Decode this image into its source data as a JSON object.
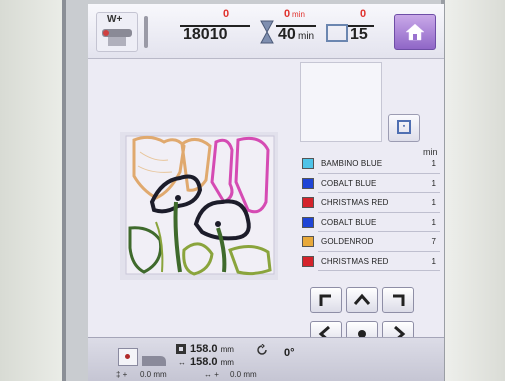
{
  "header": {
    "wplus_label": "W+",
    "stitch_count_current": "0",
    "stitch_count_total": "18010",
    "time_current": "0",
    "time_total": "40",
    "time_unit": "min",
    "color_current": "0",
    "color_total": "15"
  },
  "thread_list": {
    "unit_label": "min",
    "items": [
      {
        "name": "BAMBINO BLUE",
        "minutes": "1",
        "color": "#4ec3e8"
      },
      {
        "name": "COBALT BLUE",
        "minutes": "1",
        "color": "#1f45d6"
      },
      {
        "name": "CHRISTMAS RED",
        "minutes": "1",
        "color": "#d4232b"
      },
      {
        "name": "COBALT BLUE",
        "minutes": "1",
        "color": "#1f45d6"
      },
      {
        "name": "GOLDENROD",
        "minutes": "7",
        "color": "#e8a93a"
      },
      {
        "name": "CHRISTMAS RED",
        "minutes": "1",
        "color": "#d4232b"
      }
    ]
  },
  "status_bar": {
    "height_value": "158.0",
    "width_value": "158.0",
    "unit": "mm",
    "rotation": "0°",
    "offset_y": "0.0",
    "offset_x": "0.0"
  },
  "colors": {
    "accent_home": "#9a72cf",
    "design_pink": "#d54bb3",
    "design_orange": "#e0a96e",
    "design_green": "#3f6a2c",
    "design_olive": "#8aa43c"
  }
}
